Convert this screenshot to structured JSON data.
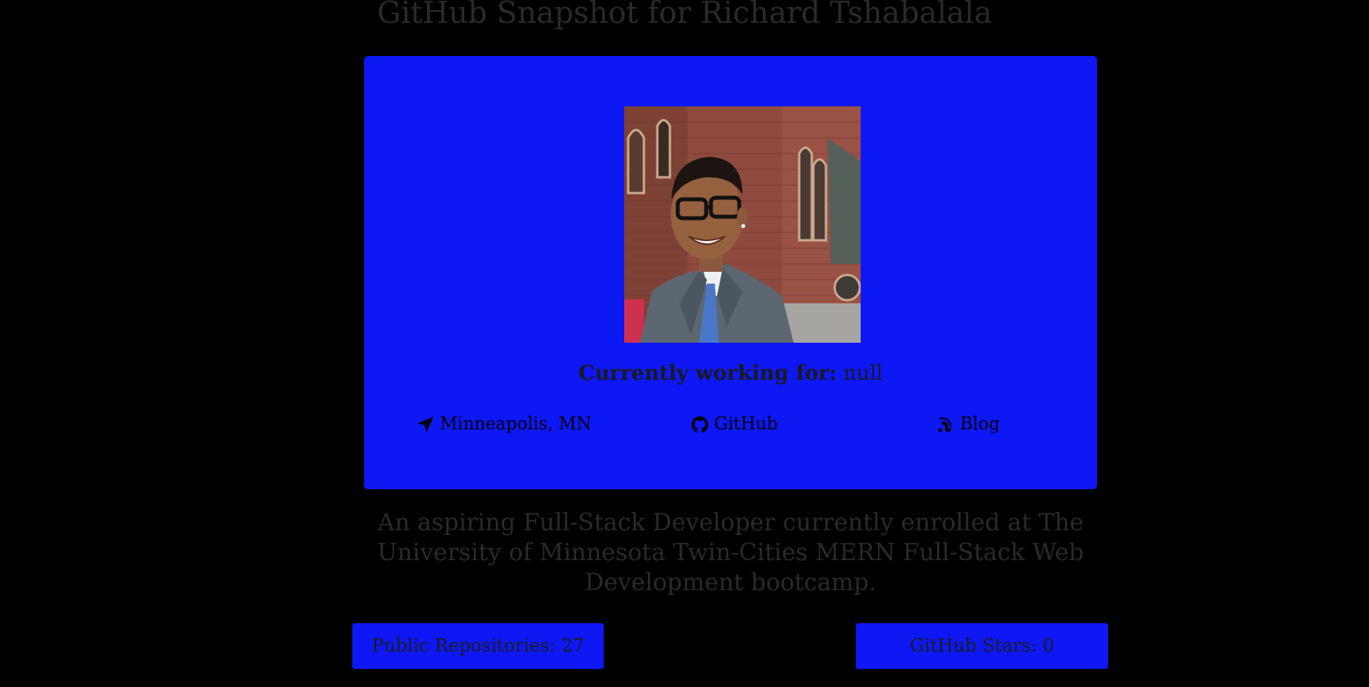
{
  "page": {
    "title": "GitHub Snapshot for Richard Tshabalala"
  },
  "profile": {
    "avatar_alt": "Profile photo of Richard Tshabalala",
    "working_label": "Currently working for:",
    "working_value": "null",
    "links": {
      "location": {
        "icon": "location-arrow-icon",
        "label": "Minneapolis, MN"
      },
      "github": {
        "icon": "github-icon",
        "label": "GitHub"
      },
      "blog": {
        "icon": "blog-icon",
        "label": "Blog"
      }
    }
  },
  "bio": {
    "text": "An aspiring Full-Stack Developer currently enrolled at The University of Minnesota Twin-Cities MERN Full-Stack Web Development bootcamp."
  },
  "stats": {
    "repos_label": "Public Repositories: 27",
    "stars_label": "GitHub Stars: 0"
  },
  "colors": {
    "background": "#000000",
    "accent": "#0d18f5",
    "muted_text": "#2a2a2a"
  }
}
